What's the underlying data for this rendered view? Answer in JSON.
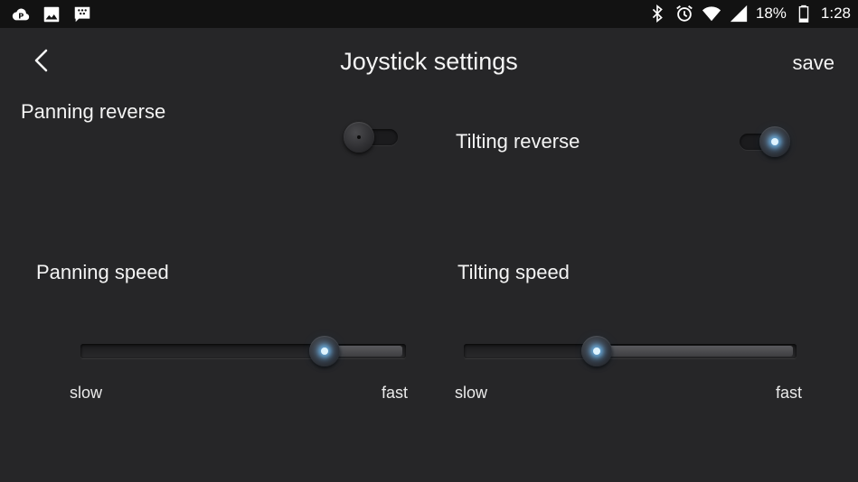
{
  "status_bar": {
    "left_icons": [
      "cloud-p-icon",
      "image-icon",
      "blackberry-icon"
    ],
    "right_icons": [
      "bluetooth-icon",
      "alarm-icon",
      "wifi-icon",
      "signal-icon",
      "battery-icon"
    ],
    "battery": "18%",
    "time": "1:28"
  },
  "header": {
    "back_icon": "chevron-left-icon",
    "title": "Joystick settings",
    "save_label": "save"
  },
  "settings": {
    "panning_reverse": {
      "label": "Panning reverse",
      "on": false
    },
    "tilting_reverse": {
      "label": "Tilting reverse",
      "on": true
    },
    "panning_speed": {
      "label": "Panning speed",
      "value": 0.75,
      "min_label": "slow",
      "max_label": "fast"
    },
    "tilting_speed": {
      "label": "Tilting speed",
      "value": 0.4,
      "min_label": "slow",
      "max_label": "fast"
    }
  },
  "colors": {
    "background": "#262628",
    "status_bar": "#121212",
    "accent_glow": "#78c8ff"
  }
}
